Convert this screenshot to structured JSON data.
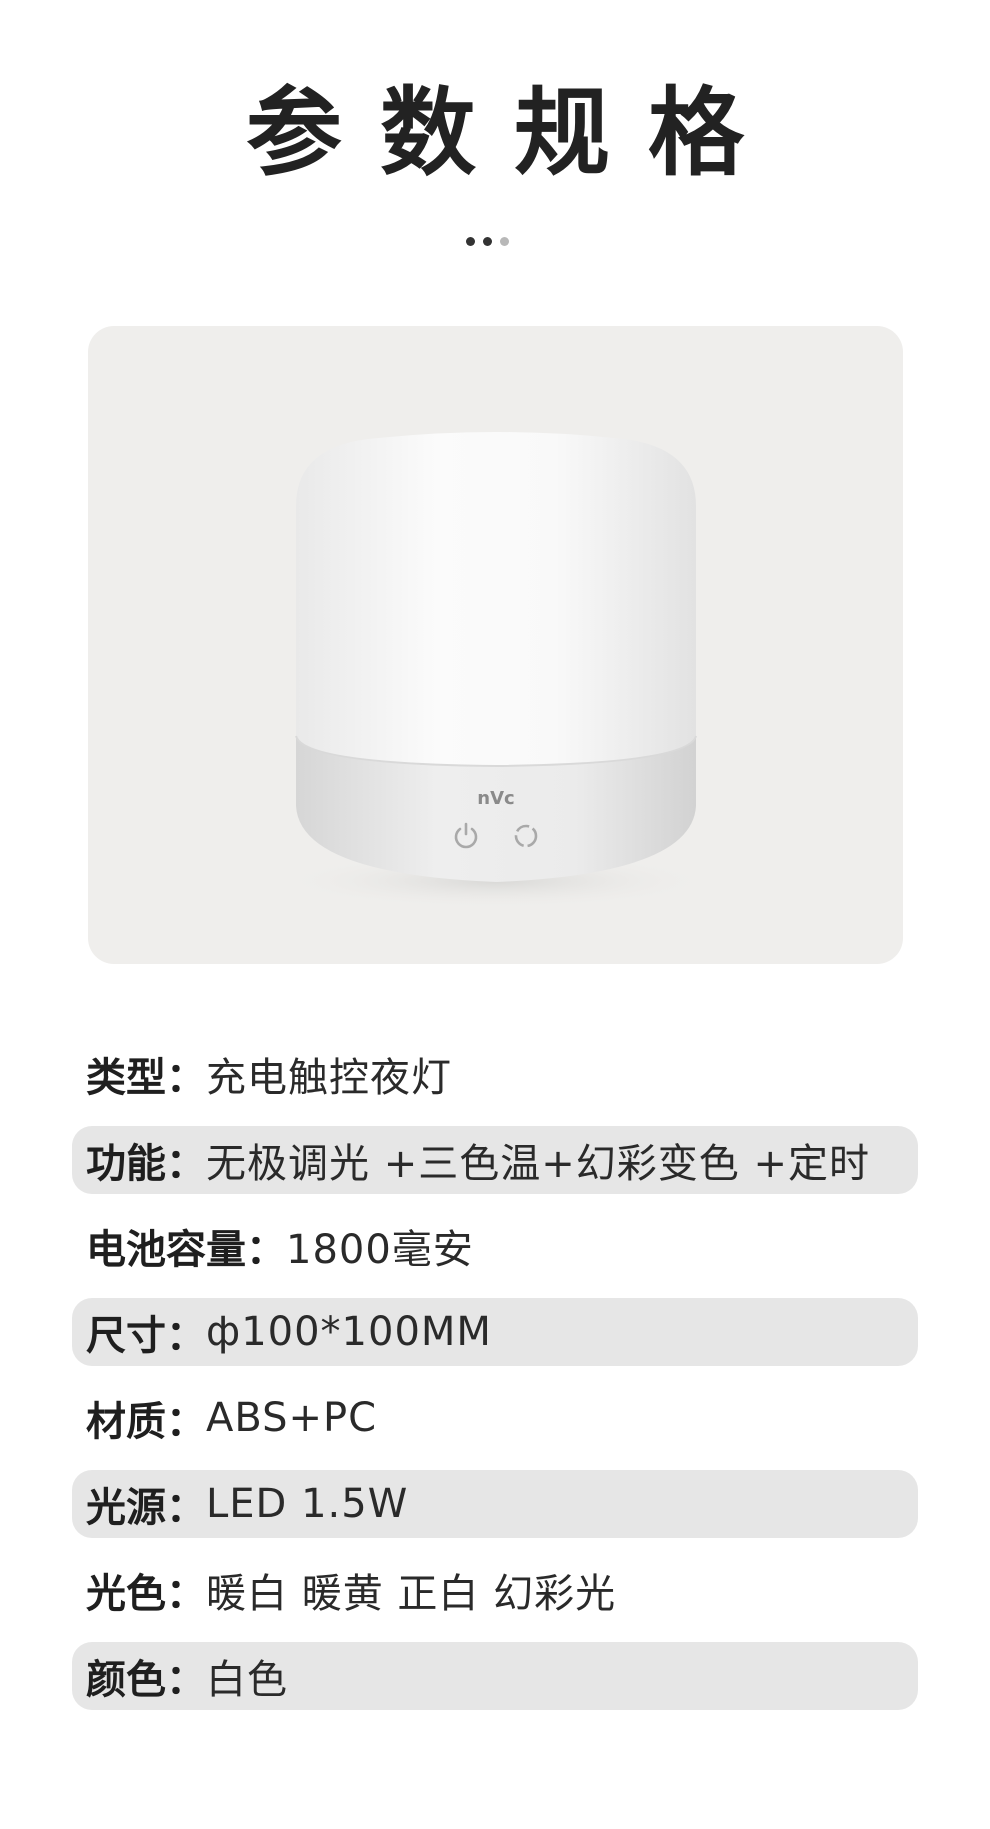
{
  "page": {
    "title": "参数规格"
  },
  "product_image": {
    "brand_logo_text": "nVc",
    "buttons": [
      "power-icon",
      "color-cycle-icon"
    ]
  },
  "specs": [
    {
      "label": "类型：",
      "value": "充电触控夜灯",
      "shaded": false
    },
    {
      "label": "功能：",
      "value": "无极调光 +三色温+幻彩变色 +定时",
      "shaded": true
    },
    {
      "label": "电池容量：",
      "value": "1800毫安",
      "shaded": false
    },
    {
      "label": "尺寸：",
      "value": "ф100*100MM",
      "shaded": true
    },
    {
      "label": "材质：",
      "value": "ABS+PC",
      "shaded": false
    },
    {
      "label": "光源：",
      "value": "LED 1.5W",
      "shaded": true
    },
    {
      "label": "光色：",
      "value": "暖白 暖黄 正白 幻彩光",
      "shaded": false
    },
    {
      "label": "颜色：",
      "value": "白色",
      "shaded": true
    }
  ],
  "colors": {
    "row_shade": "#e6e6e6",
    "photo_bg": "#efeeec",
    "text": "#222222"
  }
}
